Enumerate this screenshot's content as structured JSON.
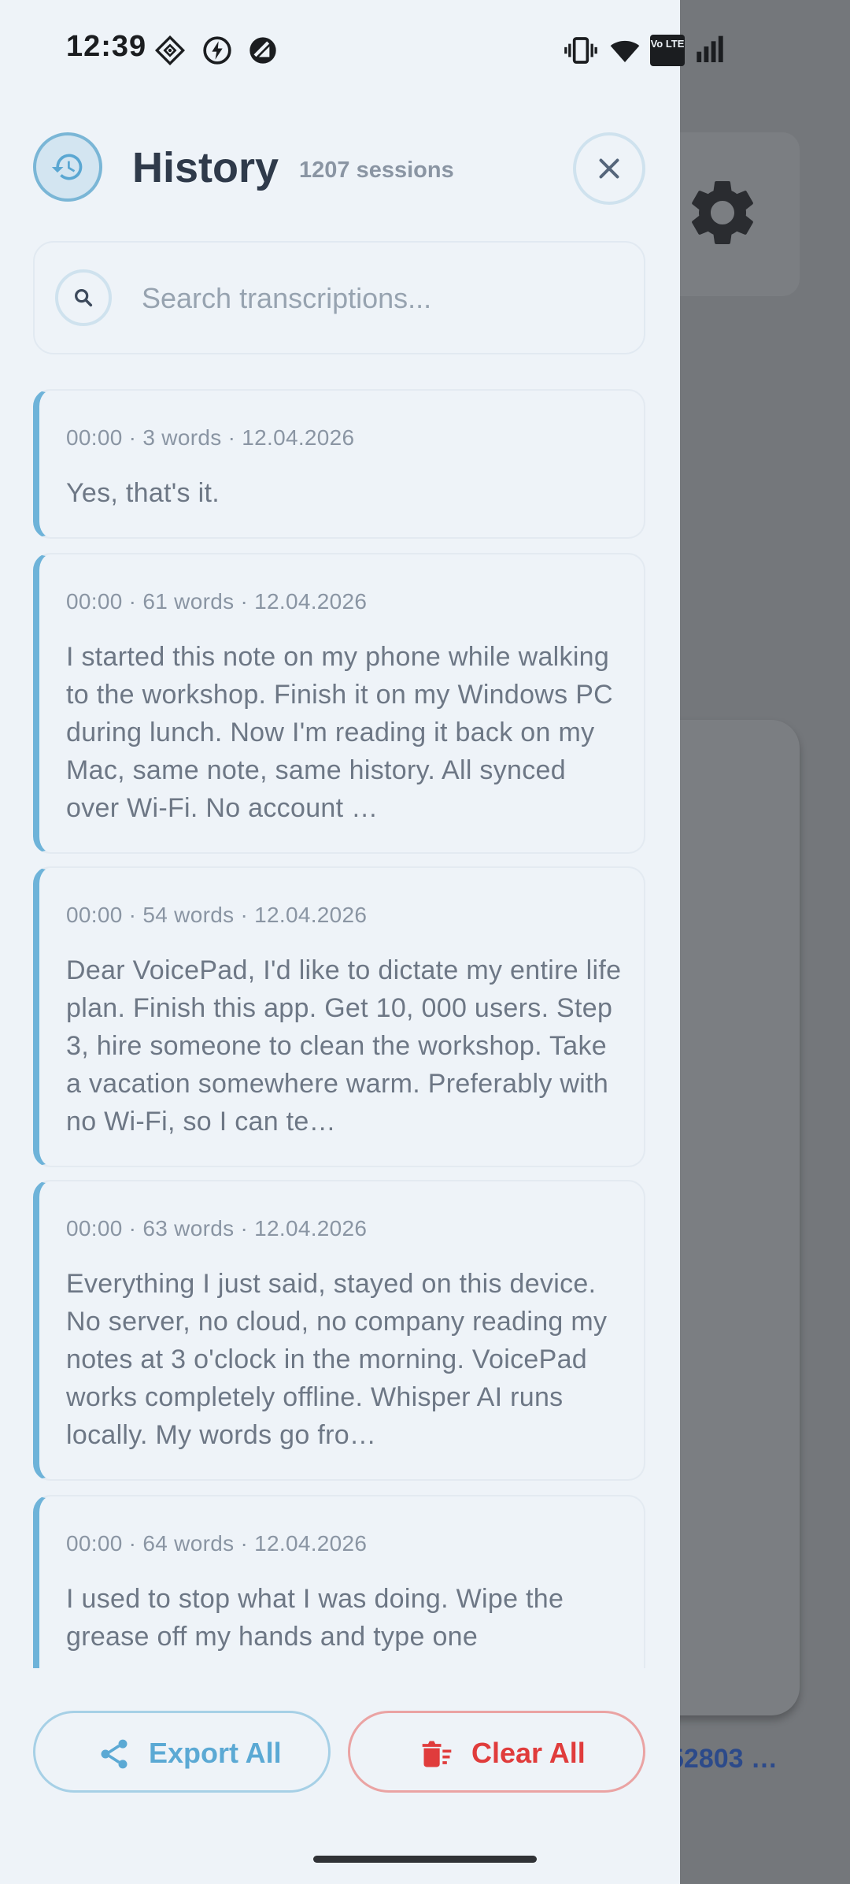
{
  "status_bar": {
    "time": "12:39",
    "left_icons": [
      "vpn-key-icon",
      "charging-bolt-icon",
      "no-entry-icon"
    ],
    "right_icons": [
      "vibrate-icon",
      "wifi-icon",
      "volte-icon",
      "signal-icon",
      "battery-charging-icon"
    ],
    "volte_text": "Vo LTE"
  },
  "header": {
    "title": "History",
    "session_count": "1207 sessions"
  },
  "search": {
    "placeholder": "Search transcriptions..."
  },
  "entries": [
    {
      "meta": "00:00 · 3 words · 12.04.2026",
      "text": "Yes, that's it."
    },
    {
      "meta": "00:00 · 61 words · 12.04.2026",
      "text": "I started this note on my phone while walking to the workshop. Finish it on my Windows PC during lunch. Now I'm reading it back on my Mac, same note, same history. All synced over Wi-Fi. No account …"
    },
    {
      "meta": "00:00 · 54 words · 12.04.2026",
      "text": "Dear VoicePad, I'd like to dictate my entire life plan. Finish this app. Get 10, 000 users. Step 3, hire someone to clean the workshop. Take a vacation somewhere warm. Preferably with no Wi-Fi, so I can te…"
    },
    {
      "meta": "00:00 · 63 words · 12.04.2026",
      "text": "Everything I just said, stayed on this device. No server, no cloud, no company reading my notes at 3 o'clock in the morning. VoicePad works completely offline. Whisper AI runs locally. My words go fro…"
    },
    {
      "meta": "00:00 · 64 words · 12.04.2026",
      "text": "I used to stop what I was doing. Wipe the grease off my hands and type one"
    }
  ],
  "actions": {
    "export_label": "Export All",
    "clear_label": "Clear All"
  },
  "background": {
    "link_text": "52803 …"
  },
  "colors": {
    "accent": "#6eb3d9",
    "danger": "#e03c3c",
    "drawer_bg": "#eef3f8"
  }
}
